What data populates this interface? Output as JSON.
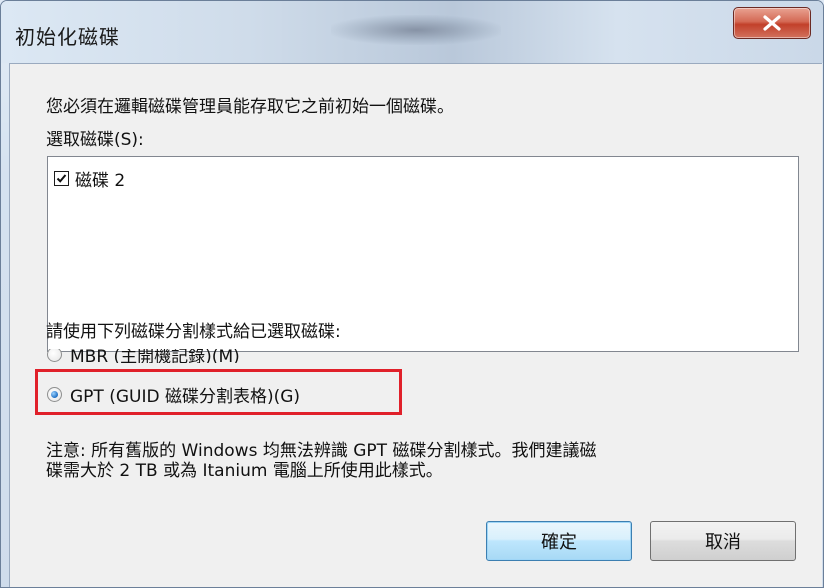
{
  "window": {
    "title": "初始化磁碟"
  },
  "dialog": {
    "intro_text": "您必須在邏輯磁碟管理員能存取它之前初始一個磁碟。",
    "select_label": "選取磁碟(S):",
    "disks": [
      {
        "label": "磁碟 2",
        "checked": true
      }
    ],
    "style_label": "請使用下列磁碟分割樣式給已選取磁碟:",
    "options": [
      {
        "label": "MBR (主開機記錄)(M)",
        "selected": false
      },
      {
        "label": "GPT (GUID 磁碟分割表格)(G)",
        "selected": true
      }
    ],
    "note_line1": "注意: 所有舊版的 Windows 均無法辨識 GPT 磁碟分割樣式。我們建議磁",
    "note_line2": "碟需大於 2 TB 或為 Itanium 電腦上所使用此樣式。",
    "ok_label": "確定",
    "cancel_label": "取消"
  },
  "colors": {
    "highlight": "#e0202a",
    "close_button": "#c2402a",
    "default_button": "#bee6fd"
  },
  "icons": {
    "close": "close-icon",
    "check": "check-icon"
  }
}
